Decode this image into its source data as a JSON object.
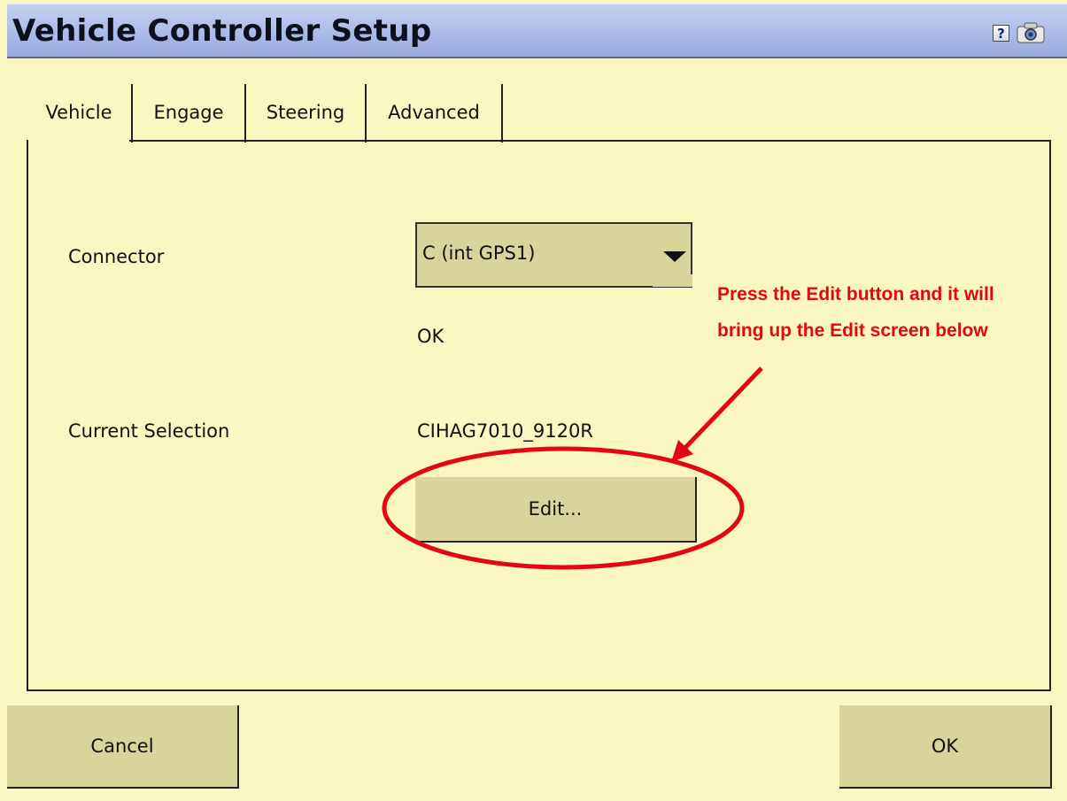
{
  "window": {
    "title": "Vehicle Controller Setup",
    "help_icon": "help-icon",
    "camera_icon": "camera-icon",
    "help_glyph": "?"
  },
  "tabs": [
    {
      "label": "Vehicle",
      "active": true
    },
    {
      "label": "Engage",
      "active": false
    },
    {
      "label": "Steering",
      "active": false
    },
    {
      "label": "Advanced",
      "active": false
    }
  ],
  "form": {
    "connector_label": "Connector",
    "connector_value": "C (int GPS1)",
    "connector_status": "OK",
    "current_selection_label": "Current Selection",
    "current_selection_value": "CIHAG7010_9120R",
    "edit_button": "Edit..."
  },
  "footer": {
    "cancel_button": "Cancel",
    "ok_button": "OK"
  },
  "annotation": {
    "text": "Press the Edit button and it will bring up the Edit screen below",
    "color": "#e30613"
  },
  "colors": {
    "background": "#fbf7c0",
    "button": "#d9d49a",
    "titlebar": "#a9b8e4"
  }
}
